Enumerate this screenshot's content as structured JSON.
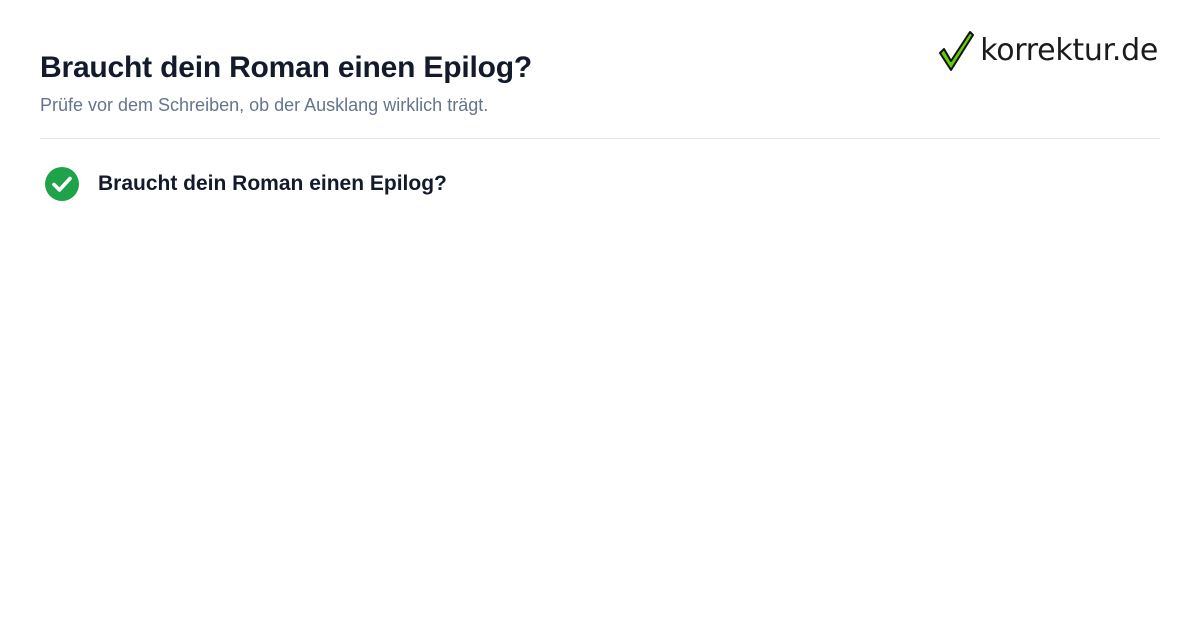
{
  "header": {
    "title": "Braucht dein Roman einen Epilog?",
    "subtitle": "Prüfe vor dem Schreiben, ob der Ausklang wirklich trägt."
  },
  "logo": {
    "text": "korrektur.de",
    "icon": "checkmark-icon",
    "check_color": "#66cc00"
  },
  "checklist": {
    "items": [
      {
        "label": "Braucht dein Roman einen Epilog?",
        "icon": "check-circle-icon",
        "status": "checked",
        "color": "#1fa34a"
      }
    ]
  },
  "colors": {
    "title": "#121a2b",
    "subtitle": "#66748b",
    "divider": "#e3e6ea",
    "background": "#ffffff"
  }
}
